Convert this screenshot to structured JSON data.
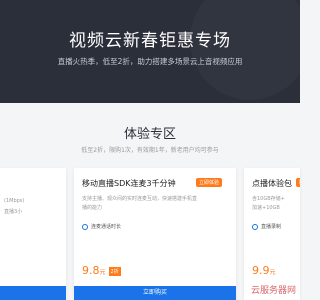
{
  "hero": {
    "title": "视频云新春钜惠专场",
    "subtitle": "直播火热季，低至2折，助力搭建多场景云上音视频应用"
  },
  "section": {
    "title": "体验专区",
    "subtitle": "低至2折，限购1次，有效期1年，新老用户均可参与"
  },
  "cards": {
    "left": {
      "line1": "(1Mbps)",
      "line2": "直播3小"
    },
    "middle": {
      "title": "移动直播SDK连麦3千分钟",
      "badge": "立即体验",
      "desc_line1": "支持主播、观众间的实时连麦互动，快速搭建手机直",
      "desc_line2": "播的能力",
      "feature": "连麦通话时长",
      "price": "9.8",
      "price_unit": "元",
      "price_tag": "2折",
      "button": "立即购买"
    },
    "right": {
      "title": "点播体验包",
      "badge": "限",
      "desc_line1": "含10GB存储+",
      "desc_line2": "加速+10GB",
      "feature": "直播录制",
      "price": "9.9",
      "price_unit": "元"
    }
  },
  "watermark": "云服务器网"
}
